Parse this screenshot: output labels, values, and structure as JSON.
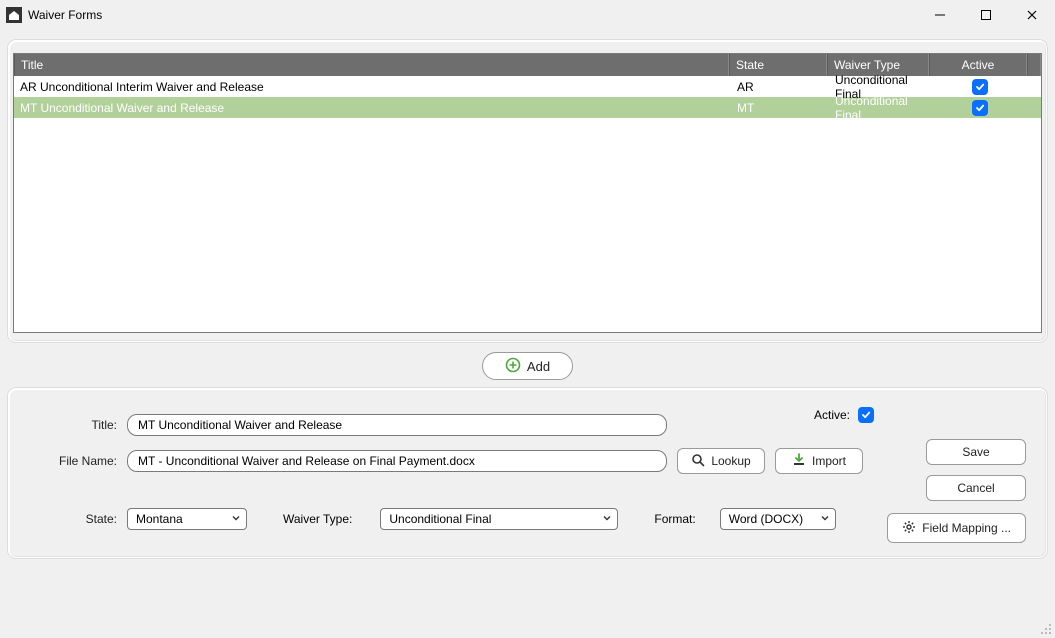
{
  "window": {
    "title": "Waiver Forms"
  },
  "grid": {
    "headers": {
      "title": "Title",
      "state": "State",
      "type": "Waiver Type",
      "active": "Active"
    },
    "rows": [
      {
        "title": "AR Unconditional Interim Waiver and Release",
        "state": "AR",
        "type": "Unconditional Final",
        "active": true,
        "selected": false
      },
      {
        "title": "MT Unconditional Waiver and Release",
        "state": "MT",
        "type": "Unconditional Final",
        "active": true,
        "selected": true
      }
    ]
  },
  "buttons": {
    "add": "Add",
    "lookup": "Lookup",
    "import": "Import",
    "save": "Save",
    "cancel": "Cancel",
    "field_mapping": "Field Mapping ..."
  },
  "form": {
    "labels": {
      "title": "Title:",
      "file_name": "File Name:",
      "state": "State:",
      "waiver_type": "Waiver Type:",
      "format": "Format:",
      "active": "Active:"
    },
    "title": "MT Unconditional Waiver and Release",
    "file_name": "MT - Unconditional Waiver and Release on Final Payment.docx",
    "state": "Montana",
    "waiver_type": "Unconditional Final",
    "format": "Word (DOCX)",
    "active": true
  }
}
